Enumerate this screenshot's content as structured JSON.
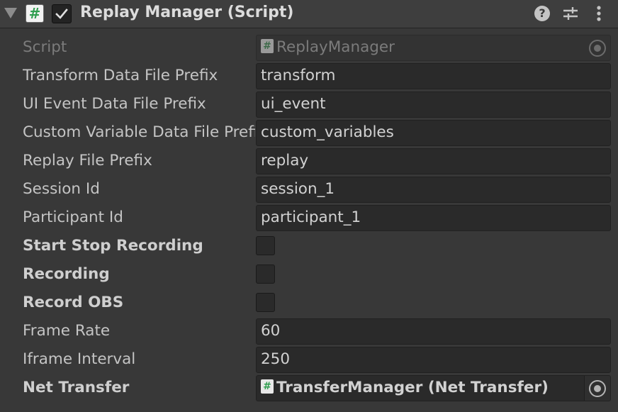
{
  "header": {
    "title": "Replay Manager (Script)",
    "script_icon": "#",
    "help_icon": "?",
    "enabled": true
  },
  "fields": {
    "script": {
      "label": "Script",
      "value": "ReplayManager",
      "icon": "#"
    },
    "transform_prefix": {
      "label": "Transform Data File Prefix",
      "value": "transform"
    },
    "ui_event_prefix": {
      "label": "UI Event Data File Prefix",
      "value": "ui_event"
    },
    "custom_var_prefix": {
      "label": "Custom Variable Data File Prefix",
      "value": "custom_variables"
    },
    "replay_prefix": {
      "label": "Replay File Prefix",
      "value": "replay"
    },
    "session_id": {
      "label": "Session Id",
      "value": "session_1"
    },
    "participant_id": {
      "label": "Participant Id",
      "value": "participant_1"
    },
    "start_stop_recording": {
      "label": "Start Stop Recording",
      "checked": false
    },
    "recording": {
      "label": "Recording",
      "checked": false
    },
    "record_obs": {
      "label": "Record OBS",
      "checked": false
    },
    "frame_rate": {
      "label": "Frame Rate",
      "value": "60"
    },
    "iframe_interval": {
      "label": "Iframe Interval",
      "value": "250"
    },
    "net_transfer": {
      "label": "Net Transfer",
      "value": "TransferManager (Net Transfer)",
      "icon": "#"
    }
  },
  "colors": {
    "background": "#383838",
    "field_background": "#2a2a2a",
    "script_icon_green": "#2f9e4f",
    "text": "#c4c4c4"
  }
}
